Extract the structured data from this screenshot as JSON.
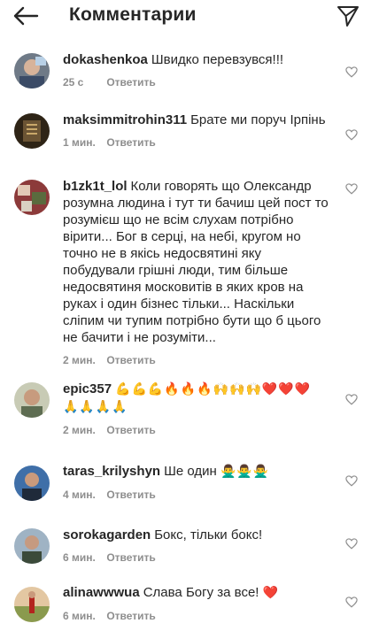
{
  "header": {
    "title": "Комментарии",
    "back_icon": "arrow-left-icon",
    "share_icon": "paper-plane-icon"
  },
  "comments": [
    {
      "username": "dokashenkoa",
      "text": "Швидко перевзувся!!!",
      "time": "25 c",
      "reply_label": "Ответить"
    },
    {
      "username": "maksimmitrohin311",
      "text": "Брате ми поруч Ірпінь",
      "time": "1 мин.",
      "reply_label": "Ответить"
    },
    {
      "username": "b1zk1t_lol",
      "text": "Коли говорять що Олександр розумна людина і тут ти бачиш цей пост то розумієш що не всім слухам потрібно вірити... Бог в серці, на небі, кругом но точно не в якісь недосвятині яку побудували  грішні люди, тим більше недосвятиня московитів в яких кров на руках і один бізнес тільки... Наскільки сліпим чи тупим потрібно бути що б цього не бачити і не розуміти...",
      "time": "2 мин.",
      "reply_label": "Ответить"
    },
    {
      "username": "epic357",
      "text": "",
      "emoji_line1": "💪💪💪🔥🔥🔥🙌🙌🙌❤️❤️❤️",
      "emoji_line2": "🙏🙏🙏🙏",
      "time": "2 мин.",
      "reply_label": "Ответить"
    },
    {
      "username": "taras_krilyshyn",
      "text": "Ше один",
      "emoji_line1": "🙅‍♂️🙅‍♂️🙅‍♂️",
      "time": "4 мин.",
      "reply_label": "Ответить"
    },
    {
      "username": "sorokagarden",
      "text": "Бокс, тільки бокс!",
      "time": "6 мин.",
      "reply_label": "Ответить"
    },
    {
      "username": "alinawwwua",
      "text": "Слава Богу за все!",
      "emoji_line1": "❤️",
      "time": "6 мин.",
      "reply_label": "Ответить"
    }
  ],
  "colors": {
    "text": "#262626",
    "secondary": "#8e8e8e",
    "heart": "#ed1c33"
  }
}
